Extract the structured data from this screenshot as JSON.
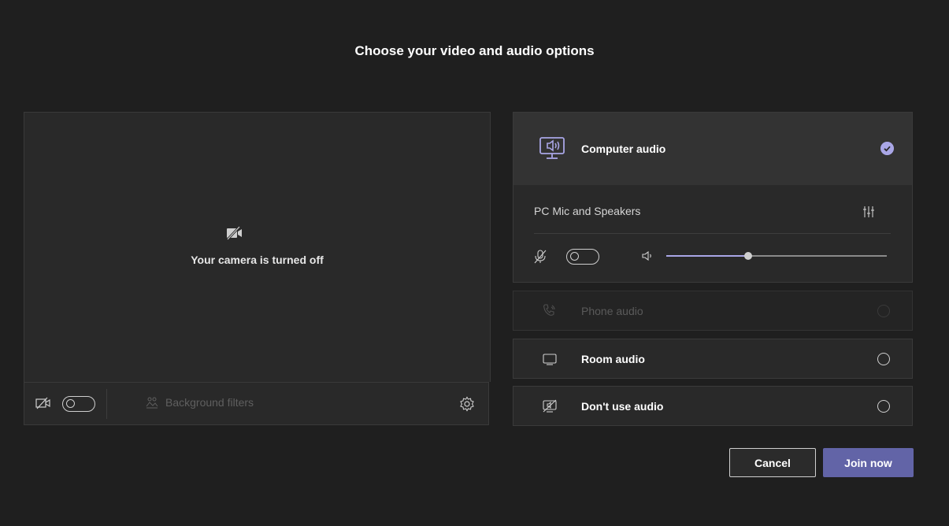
{
  "title": "Choose your video and audio options",
  "video": {
    "camera_status": "Your camera is turned off",
    "background_filters_label": "Background filters",
    "camera_toggle_on": false
  },
  "audio_options": {
    "computer": {
      "label": "Computer audio",
      "selected": true,
      "device_label": "PC Mic and Speakers",
      "mic_toggle_on": false,
      "volume_level": 0.37
    },
    "phone": {
      "label": "Phone audio",
      "selected": false,
      "disabled": true
    },
    "room": {
      "label": "Room audio",
      "selected": false
    },
    "none": {
      "label": "Don't use audio",
      "selected": false
    }
  },
  "buttons": {
    "cancel": "Cancel",
    "join": "Join now"
  },
  "colors": {
    "accent": "#6264a7",
    "accent_light": "#a9a6e6",
    "background": "#1f1f1f",
    "panel": "#292929"
  },
  "icons": [
    "camera-off-icon",
    "camera-icon",
    "background-filters-icon",
    "gear-icon",
    "speaker-monitor-icon",
    "check-circle-icon",
    "device-settings-icon",
    "mic-off-icon",
    "volume-icon",
    "phone-icon",
    "room-icon",
    "no-audio-icon"
  ]
}
